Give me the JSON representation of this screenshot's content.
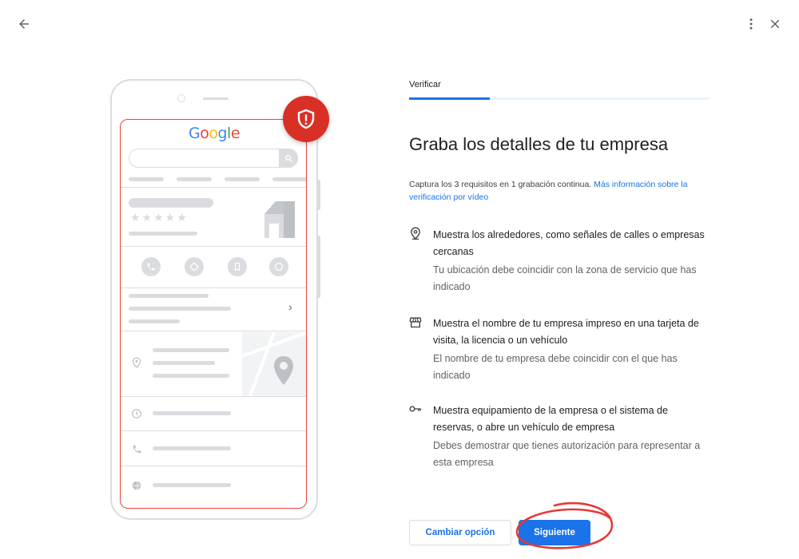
{
  "header": {
    "back_icon": "arrow-back-icon",
    "more_icon": "more-vert-icon",
    "close_icon": "close-icon"
  },
  "illustration": {
    "logo_text": "Google",
    "stars": "★★★★★",
    "badge_icon": "shield-alert-icon",
    "chevron": "›"
  },
  "stepper": {
    "label": "Verificar",
    "progress_fraction": 0.27
  },
  "main": {
    "title": "Graba los detalles de tu empresa",
    "intro_text": "Captura los 3 requisitos en 1 grabación continua.",
    "intro_link": "Más información sobre la verificación por vídeo"
  },
  "requirements": [
    {
      "icon": "location-pin-icon",
      "title": "Muestra los alrededores, como señales de calles o empresas cercanas",
      "description": "Tu ubicación debe coincidir con la zona de servicio que has indicado"
    },
    {
      "icon": "storefront-icon",
      "title": "Muestra el nombre de tu empresa impreso en una tarjeta de visita, la licencia o un vehículo",
      "description": "El nombre de tu empresa debe coincidir con el que has indicado"
    },
    {
      "icon": "key-icon",
      "title": "Muestra equipamiento de la empresa o el sistema de reservas, o abre un vehículo de empresa",
      "description": "Debes demostrar que tienes autorización para representar a esta empresa"
    }
  ],
  "footer": {
    "secondary_label": "Cambiar opción",
    "primary_label": "Siguiente"
  },
  "colors": {
    "accent": "#1a73e8",
    "badge_red": "#d93025",
    "annotation_red": "#e53935"
  }
}
